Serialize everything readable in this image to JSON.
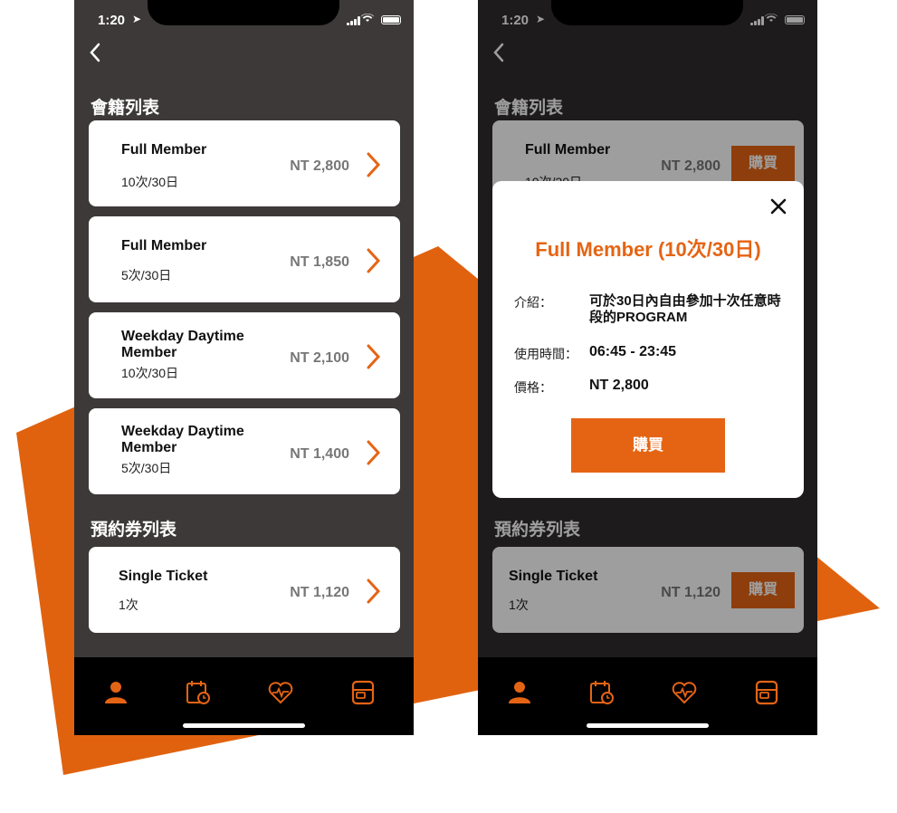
{
  "status_bar": {
    "time": "1:20"
  },
  "sections": {
    "membership": "會籍列表",
    "tickets": "預約券列表"
  },
  "memberships": [
    {
      "name": "Full Member",
      "sub": "10次/30日",
      "price": "NT 2,800"
    },
    {
      "name": "Full Member",
      "sub": "5次/30日",
      "price": "NT 1,850"
    },
    {
      "name": "Weekday Daytime Member",
      "sub": "10次/30日",
      "price": "NT 2,100"
    },
    {
      "name": "Weekday Daytime Member",
      "sub": "5次/30日",
      "price": "NT 1,400"
    }
  ],
  "tickets": [
    {
      "name": "Single Ticket",
      "sub": "1次",
      "price": "NT 1,120"
    }
  ],
  "buy_label": "購買",
  "modal": {
    "title": "Full Member (10次/30日)",
    "intro_label": "介紹：",
    "intro_value": "可於30日內自由參加十次任意時段的PROGRAM",
    "hours_label": "使用時間：",
    "hours_value": "06:45 - 23:45",
    "price_label": "價格：",
    "price_value": "NT 2,800",
    "buy_label": "購買"
  },
  "tab_icons": [
    "person-icon",
    "calendar-clock-icon",
    "heart-pulse-icon",
    "locker-icon"
  ],
  "colors": {
    "accent": "#e56414",
    "background": "#3c3938",
    "tabbar": "#000000"
  }
}
